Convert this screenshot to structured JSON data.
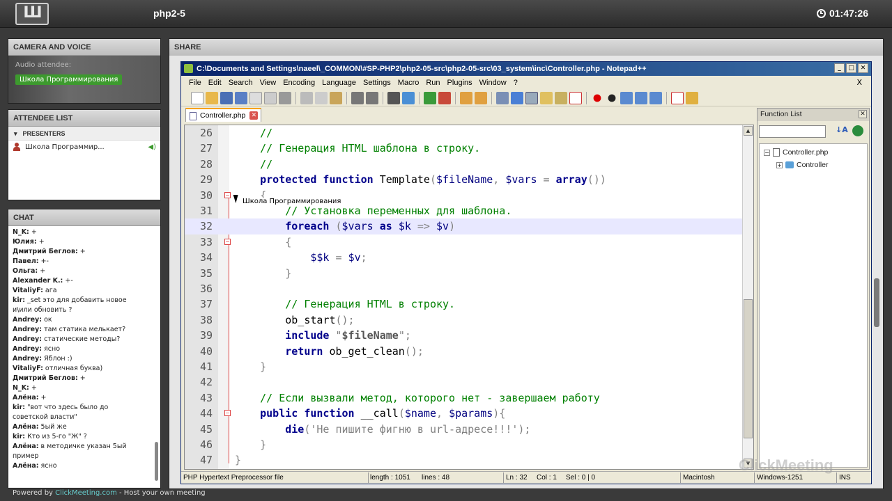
{
  "topbar": {
    "logo_text": "Ш",
    "title": "php2-5",
    "time": "01:47:26"
  },
  "camera": {
    "heading": "CAMERA AND VOICE",
    "audio_label": "Audio attendee:",
    "audio_name": "Школа Программирования"
  },
  "attendees": {
    "heading": "ATTENDEE LIST",
    "group_label": "PRESENTERS",
    "presenter_name": "Школа Программир..."
  },
  "chat": {
    "heading": "CHAT",
    "messages": [
      {
        "author": "N_K:",
        "text": " +"
      },
      {
        "author": "Юлия:",
        "text": " +"
      },
      {
        "author": "Дмитрий Беглов:",
        "text": " +"
      },
      {
        "author": "Павел:",
        "text": " +-"
      },
      {
        "author": "Ольга:",
        "text": " +"
      },
      {
        "author": "Alexander K.:",
        "text": " +-"
      },
      {
        "author": "VitaliyF:",
        "text": " ага"
      },
      {
        "author": "kir:",
        "text": " _set это для добавить новое и\\или обновить ?"
      },
      {
        "author": "Andrey:",
        "text": " ок"
      },
      {
        "author": "Andrey:",
        "text": " там статика мелькает?"
      },
      {
        "author": "Andrey:",
        "text": " статические методы?"
      },
      {
        "author": "Andrey:",
        "text": " ясно"
      },
      {
        "author": "Andrey:",
        "text": " Яблон :)"
      },
      {
        "author": "VitaliyF:",
        "text": " отличная буква)"
      },
      {
        "author": "Дмитрий Беглов:",
        "text": " +"
      },
      {
        "author": "N_K:",
        "text": " +"
      },
      {
        "author": "Алёна:",
        "text": " +"
      },
      {
        "author": "kir:",
        "text": " \"вот что здесь было до советской власти\""
      },
      {
        "author": "Алёна:",
        "text": " 5ый же"
      },
      {
        "author": "kir:",
        "text": " Кто из 5-го \"Ж\" ?"
      },
      {
        "author": "Алёна:",
        "text": " в методичке указан 5ый пример"
      },
      {
        "author": "Алёна:",
        "text": " ясно"
      }
    ]
  },
  "footer": {
    "prefix": "Powered by ",
    "brand": "ClickMeeting.com",
    "suffix": " - Host your own meeting"
  },
  "share": {
    "heading": "SHARE"
  },
  "npp": {
    "title": "C:\\Documents and Settings\\naeel\\_COMMON\\#SP-PHP2\\php2-05-src\\php2-05-src\\03_system\\inc\\Controller.php - Notepad++",
    "menu": [
      "File",
      "Edit",
      "Search",
      "View",
      "Encoding",
      "Language",
      "Settings",
      "Macro",
      "Run",
      "Plugins",
      "Window",
      "?"
    ],
    "menu_close": "X",
    "tab_label": "Controller.php",
    "tooltip": "Школа Программирования",
    "function_list": {
      "title": "Function List",
      "file": "Controller.php",
      "class": "Controller"
    },
    "status": {
      "type": "PHP Hypertext Preprocessor file",
      "length": "length : 1051",
      "lines": "lines : 48",
      "ln": "Ln : 32",
      "col": "Col : 1",
      "sel": "Sel : 0 | 0",
      "eol": "Macintosh",
      "encoding": "Windows-1251",
      "mode": "INS"
    }
  },
  "code_lines": [
    {
      "n": "26",
      "html": "    <span class='cm'>//</span>"
    },
    {
      "n": "27",
      "html": "    <span class='cm'>// Генерация HTML шаблона в строку.</span>"
    },
    {
      "n": "28",
      "html": "    <span class='cm'>//</span>"
    },
    {
      "n": "29",
      "html": "    <span class='kw'>protected function</span> Template<span class='pu'>(</span><span class='vr'>$fileName</span><span class='pu'>,</span> <span class='vr'>$vars</span> <span class='pu'>=</span> <span class='kw'>array</span><span class='pu'>())</span>"
    },
    {
      "n": "30",
      "html": "    <span class='pu'>{</span>"
    },
    {
      "n": "31",
      "html": "        <span class='cm'>// Установка переменных для шаблона.</span>"
    },
    {
      "n": "32",
      "html": "        <span class='kw'>foreach</span> <span class='pu'>(</span><span class='vr'>$vars</span> <span class='kw'>as</span> <span class='vr'>$k</span> <span class='pu'>=></span> <span class='vr'>$v</span><span class='pu'>)</span>"
    },
    {
      "n": "33",
      "html": "        <span class='pu'>{</span>"
    },
    {
      "n": "34",
      "html": "            <span class='vr'>$$k</span> <span class='pu'>=</span> <span class='vr'>$v</span><span class='pu'>;</span>"
    },
    {
      "n": "35",
      "html": "        <span class='pu'>}</span>"
    },
    {
      "n": "36",
      "html": ""
    },
    {
      "n": "37",
      "html": "        <span class='cm'>// Генерация HTML в строку.</span>"
    },
    {
      "n": "38",
      "html": "        ob_start<span class='pu'>();</span>"
    },
    {
      "n": "39",
      "html": "        <span class='kw'>include</span> <span class='st'>\"</span><span class='vr' style='font-weight:bold;color:#555'>$fileName</span><span class='st'>\"</span><span class='pu'>;</span>"
    },
    {
      "n": "40",
      "html": "        <span class='kw'>return</span> ob_get_clean<span class='pu'>();</span>"
    },
    {
      "n": "41",
      "html": "    <span class='pu'>}</span>"
    },
    {
      "n": "42",
      "html": ""
    },
    {
      "n": "43",
      "html": "    <span class='cm'>// Если вызвали метод, которого нет - завершаем работу</span>"
    },
    {
      "n": "44",
      "html": "    <span class='kw'>public function</span> __call<span class='pu'>(</span><span class='vr'>$name</span><span class='pu'>,</span> <span class='vr'>$params</span><span class='pu'>){</span>"
    },
    {
      "n": "45",
      "html": "        <span class='kw'>die</span><span class='pu'>(</span><span class='st'>'Не пишите фигню в url-адресе!!!'</span><span class='pu'>);</span>"
    },
    {
      "n": "46",
      "html": "    <span class='pu'>}</span>"
    },
    {
      "n": "47",
      "html": "<span class='pu'>}</span>"
    }
  ],
  "fold_lines": [
    "30",
    "33",
    "44"
  ],
  "current_line": "32",
  "watermark": "ClickMeeting"
}
